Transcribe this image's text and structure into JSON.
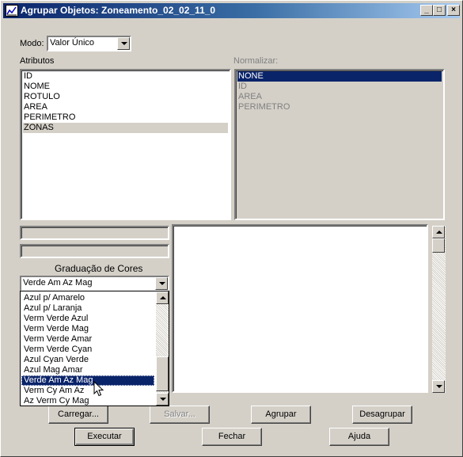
{
  "window": {
    "title": "Agrupar Objetos: Zoneamento_02_02_11_0",
    "controls": {
      "minimize": "_",
      "maximize": "□",
      "close": "×"
    }
  },
  "modo": {
    "label": "Modo:",
    "value": "Valor Único"
  },
  "atributos": {
    "label": "Atributos",
    "items": [
      "ID",
      "NOME",
      "ROTULO",
      "AREA",
      "PERIMETRO",
      "ZONAS"
    ],
    "selected": "ZONAS"
  },
  "normalizar": {
    "label": "Normalizar:",
    "items": [
      "NONE",
      "ID",
      "AREA",
      "PERIMETRO"
    ],
    "selected": "NONE"
  },
  "graduacao": {
    "label": "Graduação de Cores",
    "value": "Verde Am Az Mag",
    "options": [
      "Azul p/ Amarelo",
      "Azul p/ Laranja",
      "Verm Verde Azul",
      "Verm Verde Mag",
      "Verm Verde Amar",
      "Verm Verde Cyan",
      "Azul Cyan Verde",
      "Azul Mag Amar",
      "Verde Am Az Mag",
      "Verm Cy Am Az",
      "Az Verm Cy Mag"
    ],
    "highlighted": "Verde Am Az Mag"
  },
  "buttons": {
    "carregar": "Carregar...",
    "salvar": "Salvar...",
    "agrupar": "Agrupar",
    "desagrupar": "Desagrupar",
    "executar": "Executar",
    "fechar": "Fechar",
    "ajuda": "Ajuda"
  },
  "colors": {
    "titlebar": "#0a246a",
    "selection": "#0a246a",
    "face": "#d4d0c8"
  },
  "icons": [
    "app-icon",
    "chevron-down-icon",
    "scroll-up-icon",
    "scroll-down-icon",
    "mouse-pointer-icon"
  ]
}
